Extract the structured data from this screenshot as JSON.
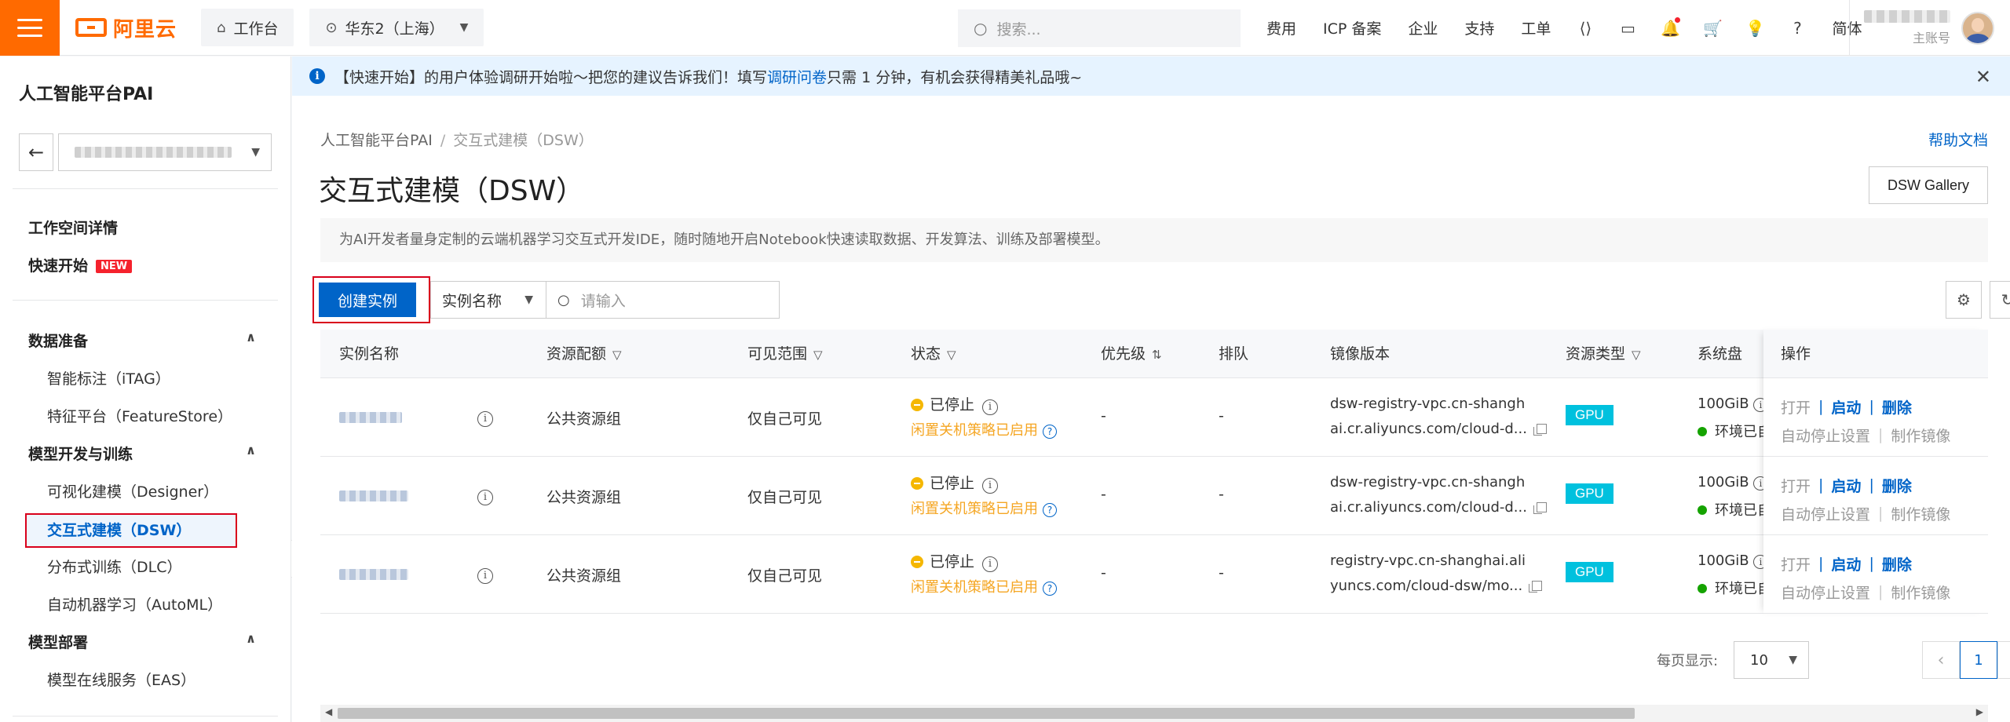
{
  "topbar": {
    "logo_text": "阿里云",
    "workbench": "工作台",
    "region": "华东2（上海）",
    "search_placeholder": "搜索...",
    "nav": [
      "费用",
      "ICP 备案",
      "企业",
      "支持",
      "工单"
    ],
    "language": "简体",
    "user_role": "主账号"
  },
  "notice": {
    "prefix": "【快速开始】的用户体验调研开始啦～把您的建议告诉我们！填写",
    "link": "调研问卷",
    "suffix": "只需 1 分钟，有机会获得精美礼品哦~"
  },
  "sidebar": {
    "title": "人工智能平台PAI",
    "items": {
      "workspace_detail": "工作空间详情",
      "quick_start": "快速开始",
      "new_badge": "NEW"
    },
    "groups": {
      "data_prep": "数据准备",
      "itag": "智能标注（iTAG）",
      "feature_store": "特征平台（FeatureStore）",
      "dev_train": "模型开发与训练",
      "designer": "可视化建模（Designer）",
      "dsw": "交互式建模（DSW）",
      "dlc": "分布式训练（DLC）",
      "automl": "自动机器学习（AutoML）",
      "deploy": "模型部署",
      "eas": "模型在线服务（EAS）"
    }
  },
  "main": {
    "breadcrumb_root": "人工智能平台PAI",
    "breadcrumb_current": "交互式建模（DSW）",
    "help": "帮助文档",
    "title": "交互式建模（DSW）",
    "gallery": "DSW Gallery",
    "description": "为AI开发者量身定制的云端机器学习交互式开发IDE，随时随地开启Notebook快速读取数据、开发算法、训练及部署模型。",
    "create_button": "创建实例",
    "filter_field": "实例名称",
    "filter_placeholder": "请输入"
  },
  "table": {
    "headers": {
      "name": "实例名称",
      "resource": "资源配额",
      "visibility": "可见范围",
      "status": "状态",
      "priority": "优先级",
      "queue": "排队",
      "image": "镜像版本",
      "rtype": "资源类型",
      "disk": "系统盘",
      "ops": "操作"
    },
    "rows": [
      {
        "resource": "公共资源组",
        "visibility": "仅自己可见",
        "status": "已停止",
        "idle": "闲置关机策略已启用",
        "priority": "-",
        "queue": "-",
        "image1": "dsw-registry-vpc.cn-shangh",
        "image2": "ai.cr.aliyuncs.com/cloud-d...",
        "rtype": "GPU",
        "disk": "100GiB",
        "env": "环境已自"
      },
      {
        "resource": "公共资源组",
        "visibility": "仅自己可见",
        "status": "已停止",
        "idle": "闲置关机策略已启用",
        "priority": "-",
        "queue": "-",
        "image1": "dsw-registry-vpc.cn-shangh",
        "image2": "ai.cr.aliyuncs.com/cloud-d...",
        "rtype": "GPU",
        "disk": "100GiB",
        "env": "环境已自"
      },
      {
        "resource": "公共资源组",
        "visibility": "仅自己可见",
        "status": "已停止",
        "idle": "闲置关机策略已启用",
        "priority": "-",
        "queue": "-",
        "image1": "registry-vpc.cn-shanghai.ali",
        "image2": "yuncs.com/cloud-dsw/mo...",
        "rtype": "GPU",
        "disk": "100GiB",
        "env": "环境已自"
      }
    ],
    "ops": {
      "open": "打开",
      "start": "启动",
      "delete": "删除",
      "auto_stop": "自动停止设置",
      "make_image": "制作镜像"
    }
  },
  "pagination": {
    "label": "每页显示:",
    "page_size": "10",
    "current": "1"
  },
  "colors": {
    "brand": "#ff6a00",
    "primary": "#0064c8",
    "highlight": "#d9001b",
    "gpu": "#00c1de"
  }
}
